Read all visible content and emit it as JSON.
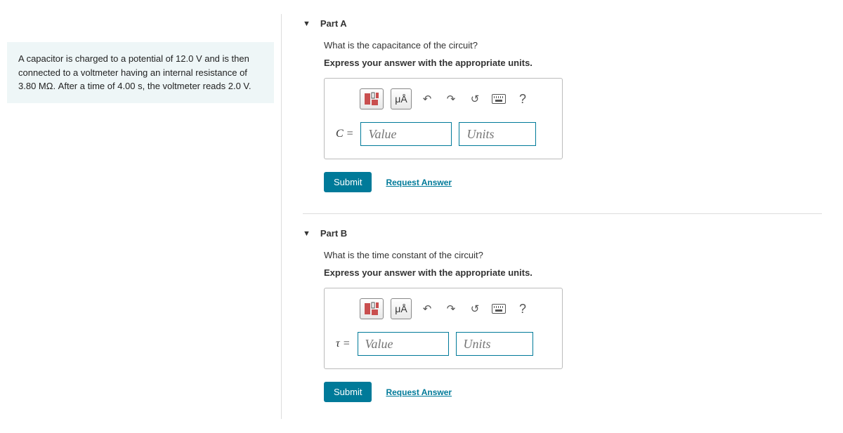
{
  "problem": {
    "text": "A capacitor is charged to a potential of 12.0 V and is then connected to a voltmeter having an internal resistance of 3.80 MΩ. After a time of 4.00 s, the voltmeter reads 2.0 V."
  },
  "parts": [
    {
      "title": "Part A",
      "question": "What is the capacitance of the circuit?",
      "instruction": "Express your answer with the appropriate units.",
      "variable": "C",
      "value_placeholder": "Value",
      "units_placeholder": "Units",
      "units_button_label": "μÅ",
      "submit_label": "Submit",
      "request_label": "Request Answer"
    },
    {
      "title": "Part B",
      "question": "What is the time constant of the circuit?",
      "instruction": "Express your answer with the appropriate units.",
      "variable": "τ",
      "value_placeholder": "Value",
      "units_placeholder": "Units",
      "units_button_label": "μÅ",
      "submit_label": "Submit",
      "request_label": "Request Answer"
    }
  ]
}
